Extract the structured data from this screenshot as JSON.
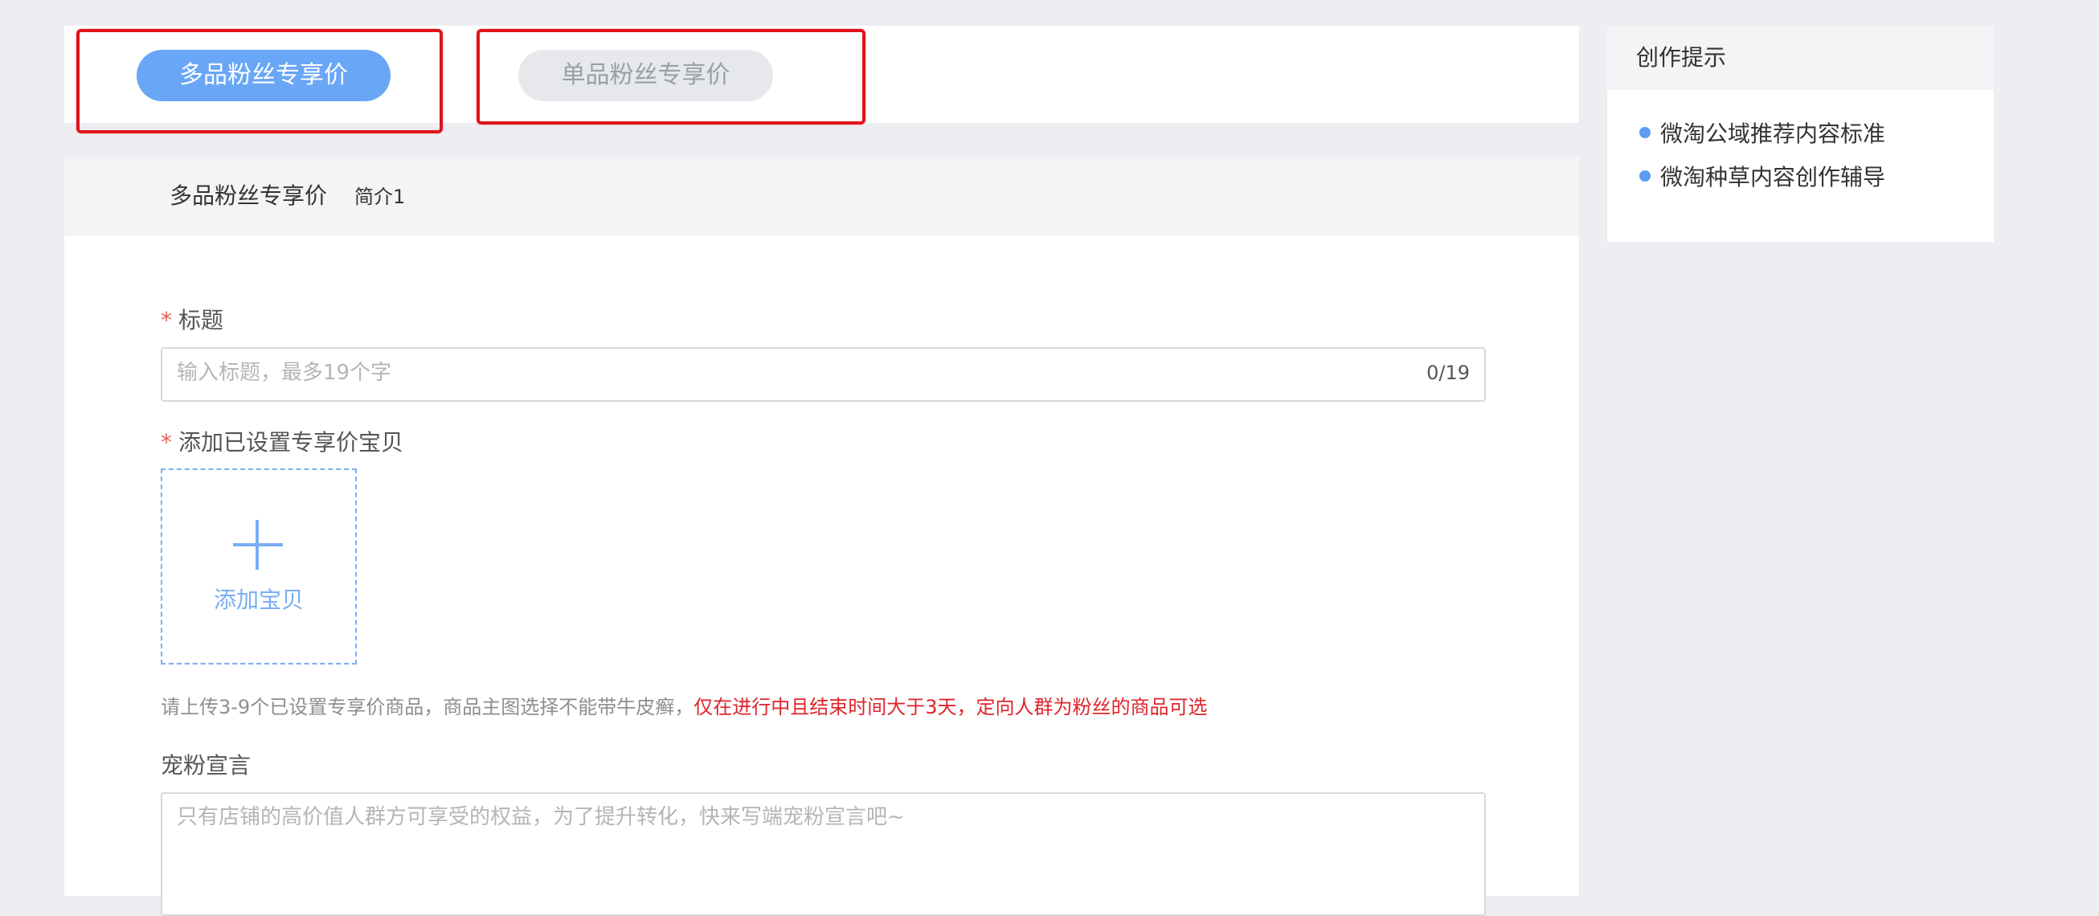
{
  "tabs": {
    "multi_label": "多品粉丝专享价",
    "single_label": "单品粉丝专享价"
  },
  "panel": {
    "title": "多品粉丝专享价",
    "subtitle": "简介1"
  },
  "form": {
    "required_mark": "*",
    "title_label": "标题",
    "title_placeholder": "输入标题，最多19个字",
    "title_counter": "0/19",
    "items_label": "添加已设置专享价宝贝",
    "add_item_label": "添加宝贝",
    "items_hint": "请上传3-9个已设置专享价商品，商品主图选择不能带牛皮癣，",
    "items_hint_red": "仅在进行中且结束时间大于3天，定向人群为粉丝的商品可选",
    "slogan_label": "宠粉宣言",
    "slogan_placeholder": "只有店铺的高价值人群方可享受的权益，为了提升转化，快来写端宠粉宣言吧~"
  },
  "side": {
    "title": "创作提示",
    "items": [
      {
        "label": "微淘公域推荐内容标准"
      },
      {
        "label": "微淘种草内容创作辅导"
      }
    ]
  },
  "colors": {
    "accent": "#69a6f5",
    "highlight": "#e0141b",
    "hint_red": "#e0242b"
  }
}
